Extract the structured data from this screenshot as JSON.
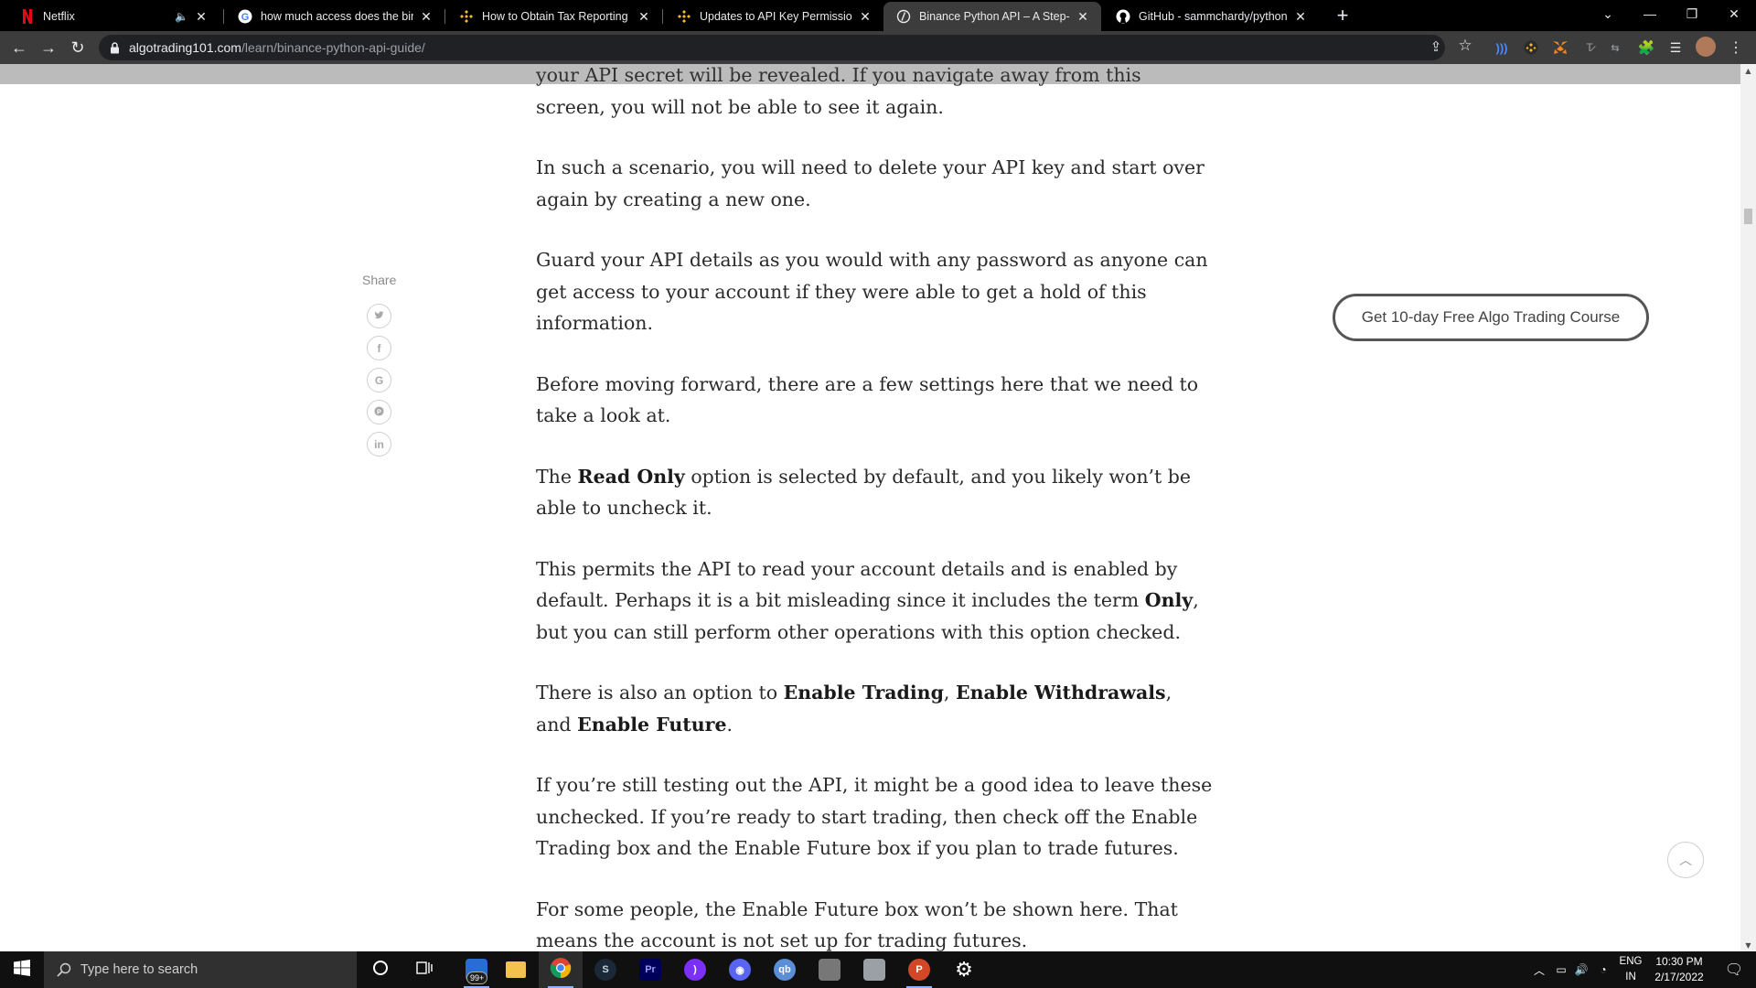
{
  "browser": {
    "tabs": [
      {
        "title": "Netflix",
        "icon": "netflix-icon",
        "muted": true
      },
      {
        "title": "how much access does the binan",
        "icon": "google-icon"
      },
      {
        "title": "How to Obtain Tax Reporting on",
        "icon": "binance-icon"
      },
      {
        "title": "Updates to API Key Permission R",
        "icon": "binance-icon"
      },
      {
        "title": "Binance Python API – A Step-by-",
        "icon": "algotrading-icon",
        "active": true
      },
      {
        "title": "GitHub - sammchardy/python-bi",
        "icon": "github-icon"
      }
    ],
    "url_domain": "algotrading101.com",
    "url_path": "/learn/binance-python-api-guide/"
  },
  "article": {
    "paragraphs": [
      {
        "text": "your API secret will be revealed. If you navigate away from this screen, you will not be able to see it again."
      },
      {
        "text": "In such a scenario, you will need to delete your API key and start over again by creating a new one."
      },
      {
        "text": "Guard your API details as you would with any password as anyone can get access to your account if they were able to get a hold of this information."
      },
      {
        "text": "Before moving forward, there are a few settings here that we need to take a look at."
      },
      {
        "segments": [
          {
            "t": "The "
          },
          {
            "t": "Read Only",
            "b": true
          },
          {
            "t": " option is selected by default, and you likely won’t be able to uncheck it."
          }
        ]
      },
      {
        "segments": [
          {
            "t": "This permits the API to read your account details and is enabled by default. Perhaps it is a bit misleading since it includes the term "
          },
          {
            "t": "Only",
            "b": true
          },
          {
            "t": ", but you can still perform other operations with this option checked."
          }
        ]
      },
      {
        "segments": [
          {
            "t": "There is also an option to "
          },
          {
            "t": "Enable Trading",
            "b": true
          },
          {
            "t": ", "
          },
          {
            "t": "Enable Withdrawals",
            "b": true
          },
          {
            "t": ", and "
          },
          {
            "t": "Enable Future",
            "b": true
          },
          {
            "t": "."
          }
        ]
      },
      {
        "text": "If you’re still testing out the API, it might be a good idea to leave these unchecked. If you’re ready to start trading, then check off the Enable Trading box and the Enable Future box if you plan to trade futures."
      },
      {
        "text": "For some people, the Enable Future box won’t be shown here. That means the account is not set up for trading futures."
      }
    ]
  },
  "share": {
    "label": "Share",
    "buttons": [
      {
        "name": "twitter",
        "glyph": "🐦"
      },
      {
        "name": "facebook",
        "glyph": "f"
      },
      {
        "name": "google",
        "glyph": "G"
      },
      {
        "name": "pinterest",
        "glyph": "P"
      },
      {
        "name": "linkedin",
        "glyph": "in"
      }
    ]
  },
  "cta": {
    "label": "Get 10-day Free Algo Trading Course"
  },
  "taskbar": {
    "search_placeholder": "Type here to search",
    "notification_badge": "99+",
    "language": "ENG",
    "region": "IN",
    "time": "10:30 PM",
    "date": "2/17/2022"
  },
  "colors": {
    "tab_bg": "#000000",
    "active_tab": "#3c3c3c",
    "omnibox": "#202124",
    "article_text": "#2b2b2b",
    "taskbar": "#101010"
  }
}
